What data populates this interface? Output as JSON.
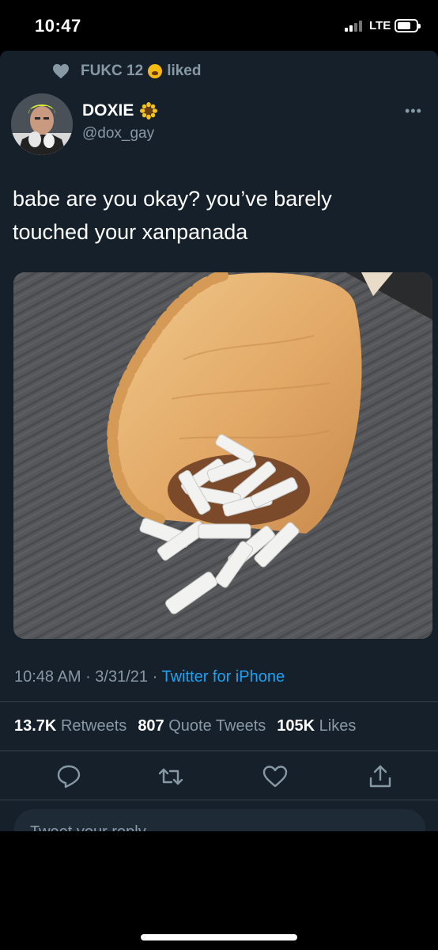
{
  "status_bar": {
    "time": "10:47",
    "network": "LTE"
  },
  "liked_by": {
    "name": "FUKC 12",
    "action": "liked"
  },
  "author": {
    "display_name": "DOXIE",
    "handle": "@dox_gay"
  },
  "tweet": {
    "line1": "babe are you okay? you’ve barely",
    "line2": "touched your xanpanada",
    "time": "10:48 AM",
    "date": "3/31/21",
    "source": "Twitter for iPhone"
  },
  "stats": {
    "retweets_count": "13.7K",
    "retweets_label": "Retweets",
    "quotes_count": "807",
    "quotes_label": "Quote Tweets",
    "likes_count": "105K",
    "likes_label": "Likes"
  },
  "reply": {
    "placeholder": "Tweet your reply"
  },
  "icons": [
    "heart-icon",
    "sunflower-icon",
    "more-icon",
    "reply-icon",
    "retweet-icon",
    "like-icon",
    "share-icon"
  ],
  "colors": {
    "background": "#15202b",
    "secondary_text": "#8899a6",
    "link": "#1da1f2",
    "divider": "#38444d"
  }
}
